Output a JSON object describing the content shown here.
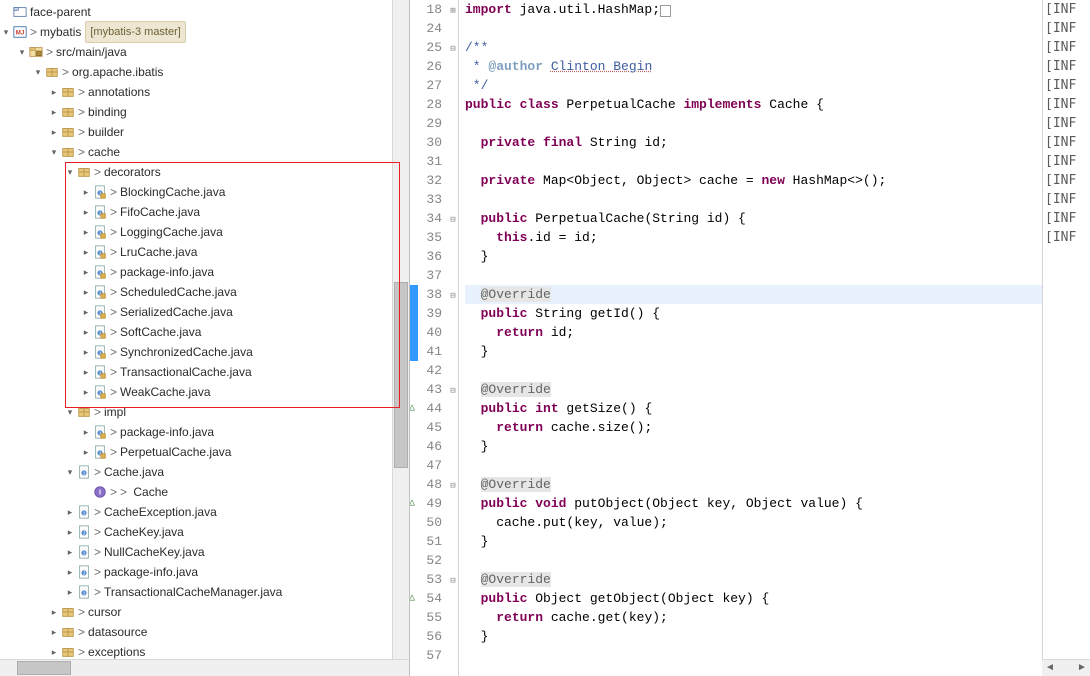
{
  "explorer": {
    "project_root": "face-parent",
    "module": "mybatis",
    "module_repo": "[mybatis-3 master]",
    "src_folder": "src/main/java",
    "package_root": "org.apache.ibatis",
    "packages": {
      "annotations": "annotations",
      "binding": "binding",
      "builder": "builder",
      "cache": "cache",
      "cursor": "cursor",
      "datasource": "datasource",
      "exceptions": "exceptions"
    },
    "cache": {
      "decorators": "decorators",
      "impl": "impl",
      "files": {
        "cachejava": "Cache.java",
        "cache_type": "Cache",
        "cacheexception": "CacheException.java",
        "cachekey": "CacheKey.java",
        "nullcachekey": "NullCacheKey.java",
        "packageinfo": "package-info.java",
        "tcm": "TransactionalCacheManager.java"
      },
      "decorators_files": [
        "BlockingCache.java",
        "FifoCache.java",
        "LoggingCache.java",
        "LruCache.java",
        "package-info.java",
        "ScheduledCache.java",
        "SerializedCache.java",
        "SoftCache.java",
        "SynchronizedCache.java",
        "TransactionalCache.java",
        "WeakCache.java"
      ],
      "impl_files": [
        "package-info.java",
        "PerpetualCache.java"
      ]
    }
  },
  "code": {
    "lines": [
      {
        "n": "18",
        "anno": "plus",
        "text_parts": [
          {
            "c": "kw-purple",
            "t": "import"
          },
          {
            "c": "",
            "t": " java.util.HashMap;"
          }
        ],
        "tail": "box"
      },
      {
        "n": "24",
        "text_parts": []
      },
      {
        "n": "25",
        "anno": "fold",
        "text_parts": [
          {
            "c": "doc",
            "t": "/**"
          }
        ]
      },
      {
        "n": "26",
        "text_parts": [
          {
            "c": "doc",
            "t": " * "
          },
          {
            "c": "doc-tag",
            "t": "@author"
          },
          {
            "c": "doc",
            "t": " "
          },
          {
            "c": "author",
            "t": "Clinton Begin"
          }
        ]
      },
      {
        "n": "27",
        "text_parts": [
          {
            "c": "doc",
            "t": " */"
          }
        ]
      },
      {
        "n": "28",
        "text_parts": [
          {
            "c": "kw-purple",
            "t": "public class"
          },
          {
            "c": "",
            "t": " PerpetualCache "
          },
          {
            "c": "kw-purple",
            "t": "implements"
          },
          {
            "c": "",
            "t": " Cache {"
          }
        ]
      },
      {
        "n": "29",
        "text_parts": []
      },
      {
        "n": "30",
        "text_parts": [
          {
            "c": "",
            "t": "  "
          },
          {
            "c": "kw-purple",
            "t": "private final"
          },
          {
            "c": "",
            "t": " String id;"
          }
        ]
      },
      {
        "n": "31",
        "text_parts": []
      },
      {
        "n": "32",
        "text_parts": [
          {
            "c": "",
            "t": "  "
          },
          {
            "c": "kw-purple",
            "t": "private"
          },
          {
            "c": "",
            "t": " Map<Object, Object> cache = "
          },
          {
            "c": "kw-purple",
            "t": "new"
          },
          {
            "c": "",
            "t": " HashMap<>();"
          }
        ]
      },
      {
        "n": "33",
        "text_parts": []
      },
      {
        "n": "34",
        "anno": "fold",
        "text_parts": [
          {
            "c": "",
            "t": "  "
          },
          {
            "c": "kw-purple",
            "t": "public"
          },
          {
            "c": "",
            "t": " PerpetualCache(String id) {"
          }
        ]
      },
      {
        "n": "35",
        "text_parts": [
          {
            "c": "",
            "t": "    "
          },
          {
            "c": "kw-purple",
            "t": "this"
          },
          {
            "c": "",
            "t": ".id = id;"
          }
        ]
      },
      {
        "n": "36",
        "text_parts": [
          {
            "c": "",
            "t": "  }"
          }
        ]
      },
      {
        "n": "37",
        "text_parts": []
      },
      {
        "n": "38",
        "anno": "fold",
        "hl": true,
        "text_parts": [
          {
            "c": "",
            "t": "  "
          },
          {
            "c": "ann",
            "t": "@Override"
          }
        ]
      },
      {
        "n": "39",
        "anno": "override",
        "text_parts": [
          {
            "c": "",
            "t": "  "
          },
          {
            "c": "kw-purple",
            "t": "public"
          },
          {
            "c": "",
            "t": " String getId() {"
          }
        ]
      },
      {
        "n": "40",
        "text_parts": [
          {
            "c": "",
            "t": "    "
          },
          {
            "c": "kw-purple",
            "t": "return"
          },
          {
            "c": "",
            "t": " id;"
          }
        ]
      },
      {
        "n": "41",
        "text_parts": [
          {
            "c": "",
            "t": "  }"
          }
        ]
      },
      {
        "n": "42",
        "text_parts": []
      },
      {
        "n": "43",
        "anno": "fold",
        "text_parts": [
          {
            "c": "",
            "t": "  "
          },
          {
            "c": "ann",
            "t": "@Override"
          }
        ]
      },
      {
        "n": "44",
        "anno": "override",
        "text_parts": [
          {
            "c": "",
            "t": "  "
          },
          {
            "c": "kw-purple",
            "t": "public int"
          },
          {
            "c": "",
            "t": " getSize() {"
          }
        ]
      },
      {
        "n": "45",
        "text_parts": [
          {
            "c": "",
            "t": "    "
          },
          {
            "c": "kw-purple",
            "t": "return"
          },
          {
            "c": "",
            "t": " cache.size();"
          }
        ]
      },
      {
        "n": "46",
        "text_parts": [
          {
            "c": "",
            "t": "  }"
          }
        ]
      },
      {
        "n": "47",
        "text_parts": []
      },
      {
        "n": "48",
        "anno": "fold",
        "text_parts": [
          {
            "c": "",
            "t": "  "
          },
          {
            "c": "ann",
            "t": "@Override"
          }
        ]
      },
      {
        "n": "49",
        "anno": "override",
        "text_parts": [
          {
            "c": "",
            "t": "  "
          },
          {
            "c": "kw-purple",
            "t": "public void"
          },
          {
            "c": "",
            "t": " putObject(Object key, Object value) {"
          }
        ]
      },
      {
        "n": "50",
        "text_parts": [
          {
            "c": "",
            "t": "    cache.put(key, value);"
          }
        ]
      },
      {
        "n": "51",
        "text_parts": [
          {
            "c": "",
            "t": "  }"
          }
        ]
      },
      {
        "n": "52",
        "text_parts": []
      },
      {
        "n": "53",
        "anno": "fold",
        "text_parts": [
          {
            "c": "",
            "t": "  "
          },
          {
            "c": "ann",
            "t": "@Override"
          }
        ]
      },
      {
        "n": "54",
        "anno": "override",
        "text_parts": [
          {
            "c": "",
            "t": "  "
          },
          {
            "c": "kw-purple",
            "t": "public"
          },
          {
            "c": "",
            "t": " Object getObject(Object key) {"
          }
        ]
      },
      {
        "n": "55",
        "text_parts": [
          {
            "c": "",
            "t": "    "
          },
          {
            "c": "kw-purple",
            "t": "return"
          },
          {
            "c": "",
            "t": " cache.get(key);"
          }
        ]
      },
      {
        "n": "56",
        "text_parts": [
          {
            "c": "",
            "t": "  }"
          }
        ]
      },
      {
        "n": "57",
        "text_parts": []
      }
    ]
  },
  "right_panel": {
    "inf": "[INF"
  }
}
